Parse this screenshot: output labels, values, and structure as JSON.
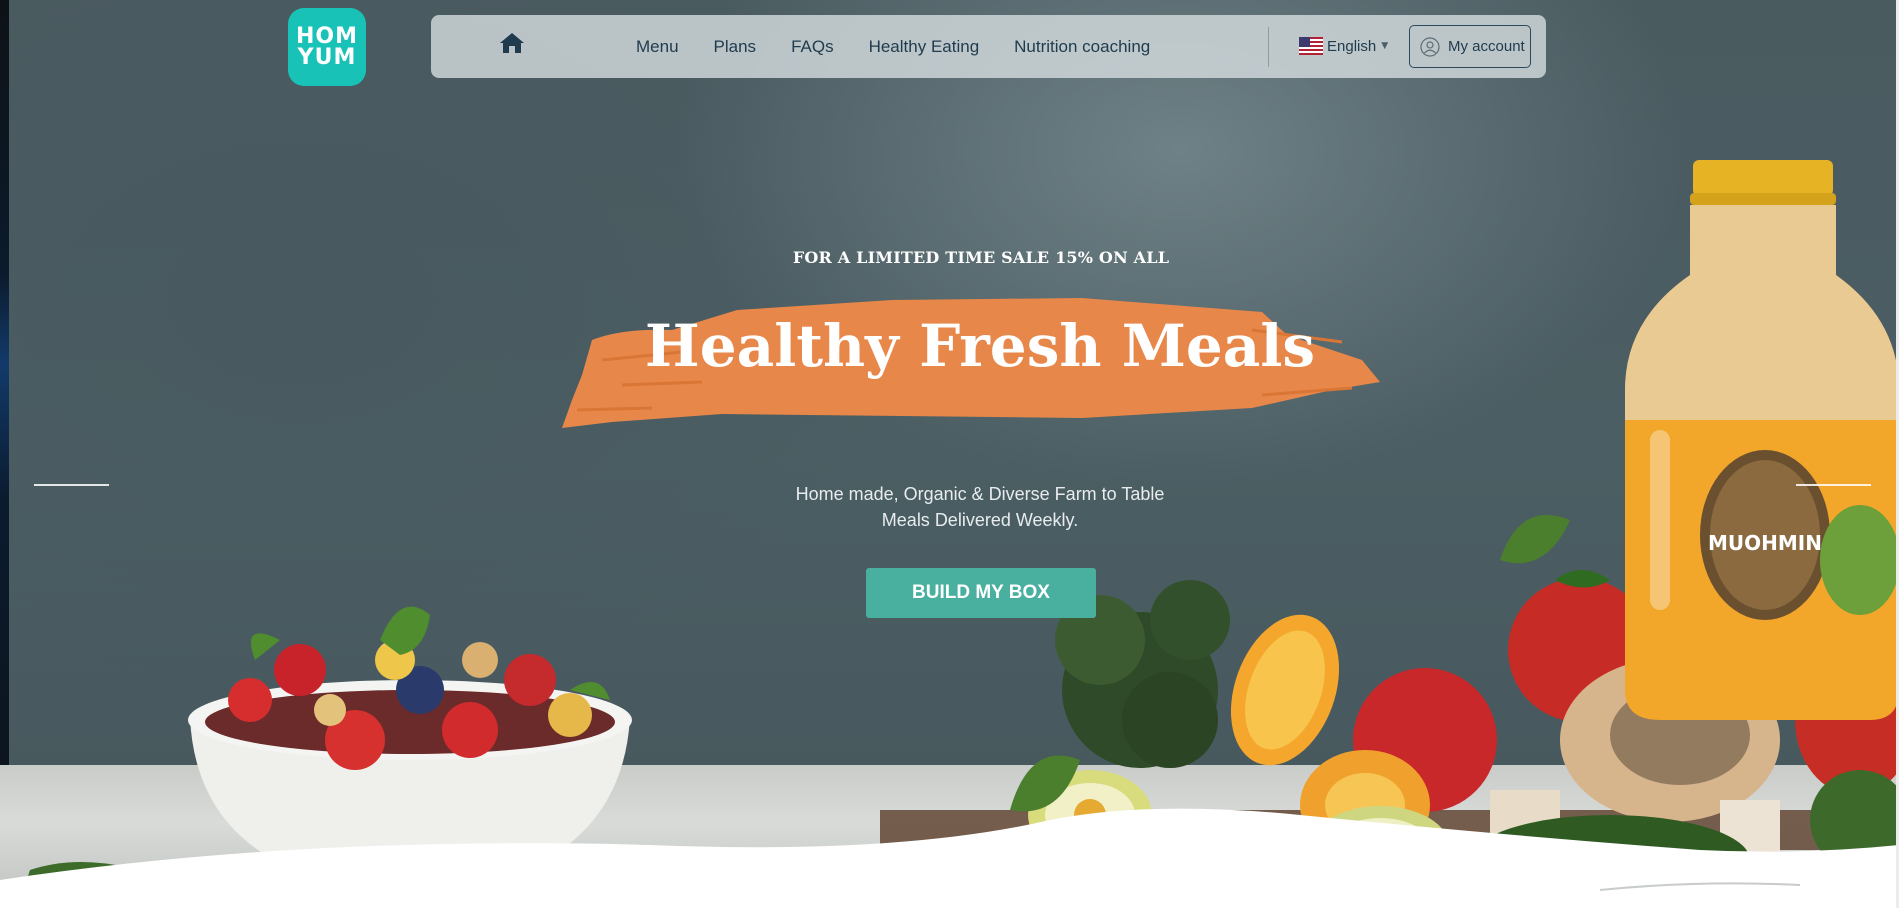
{
  "brand": {
    "logo_line1": "HOM",
    "logo_line2": "YUM",
    "logo_color": "#19c2b7"
  },
  "nav": {
    "home_icon": "home-icon",
    "links": [
      "Menu",
      "Plans",
      "FAQs",
      "Healthy Eating",
      "Nutrition coaching"
    ],
    "language": "English",
    "language_flag": "us-flag-icon",
    "account_label": "My account",
    "account_icon": "user-icon"
  },
  "hero": {
    "promo": "FOR A LIMITED TIME SALE 15% ON ALL",
    "headline": "Healthy Fresh Meals",
    "subtitle_line1": "Home made, Organic & Diverse Farm to Table",
    "subtitle_line2": "Meals Delivered Weekly.",
    "cta_label": "BUILD MY BOX",
    "accent_color": "#e8874a",
    "cta_color": "#49b0a0"
  },
  "slider": {
    "prev_indicator": "slide-indicator-left",
    "next_indicator": "slide-indicator-right"
  },
  "imagery": {
    "bottle_label": "MUOHMIN"
  }
}
